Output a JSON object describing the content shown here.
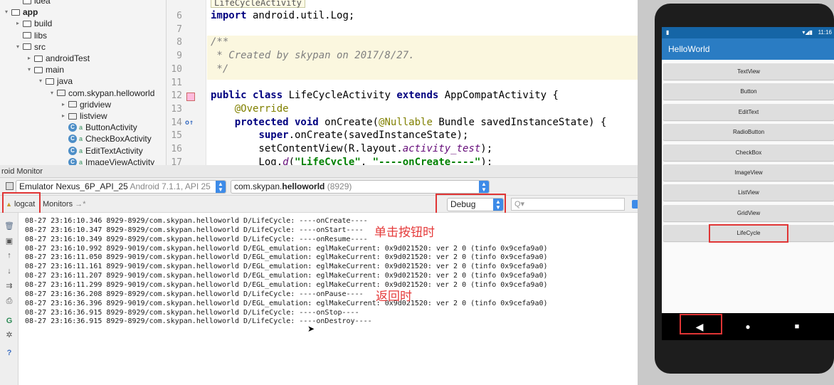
{
  "project_tree": [
    {
      "label": "idea",
      "indent": 1,
      "type": "folder",
      "twisty": "",
      "bold": false
    },
    {
      "label": "app",
      "indent": 0,
      "type": "folder",
      "twisty": "▾",
      "bold": true
    },
    {
      "label": "build",
      "indent": 1,
      "type": "folder",
      "twisty": "▸",
      "bold": false
    },
    {
      "label": "libs",
      "indent": 1,
      "type": "folder",
      "twisty": "",
      "bold": false
    },
    {
      "label": "src",
      "indent": 1,
      "type": "folder",
      "twisty": "▾",
      "bold": false
    },
    {
      "label": "androidTest",
      "indent": 2,
      "type": "folder",
      "twisty": "▸",
      "bold": false
    },
    {
      "label": "main",
      "indent": 2,
      "type": "folder",
      "twisty": "▾",
      "bold": false
    },
    {
      "label": "java",
      "indent": 3,
      "type": "folder",
      "twisty": "▾",
      "bold": false
    },
    {
      "label": "com.skypan.helloworld",
      "indent": 4,
      "type": "package",
      "twisty": "▾",
      "bold": false
    },
    {
      "label": "gridview",
      "indent": 5,
      "type": "package",
      "twisty": "▸",
      "bold": false
    },
    {
      "label": "listview",
      "indent": 5,
      "type": "package",
      "twisty": "▸",
      "bold": false
    },
    {
      "label": "ButtonActivity",
      "indent": 5,
      "type": "class",
      "twisty": "",
      "bold": false
    },
    {
      "label": "CheckBoxActivity",
      "indent": 5,
      "type": "class",
      "twisty": "",
      "bold": false
    },
    {
      "label": "EditTextActivity",
      "indent": 5,
      "type": "class",
      "twisty": "",
      "bold": false
    },
    {
      "label": "ImageViewActivity",
      "indent": 5,
      "type": "class",
      "twisty": "",
      "bold": false
    }
  ],
  "editor": {
    "tab_hint": "LifeCycleActivity",
    "lines": [
      {
        "n": "6",
        "html": "<span class=\"kw\">import</span> android.util.Log;"
      },
      {
        "n": "7",
        "html": ""
      },
      {
        "n": "8",
        "html": "<span class=\"cm\">/**</span>"
      },
      {
        "n": "9",
        "html": "<span class=\"cm\"> * Created by skypan on 2017/8/27.</span>"
      },
      {
        "n": "10",
        "html": "<span class=\"cm\"> */</span>"
      },
      {
        "n": "11",
        "html": ""
      },
      {
        "n": "12",
        "html": "<span class=\"kw\">public class</span> LifeCycleActivity <span class=\"kw\">extends</span> AppCompatActivity {"
      },
      {
        "n": "13",
        "html": "    <span class=\"an\">@Override</span>"
      },
      {
        "n": "14",
        "html": "    <span class=\"kw\">protected void</span> onCreate(<span class=\"an\">@Nullable</span> Bundle savedInstanceState) {"
      },
      {
        "n": "15",
        "html": "        <span class=\"kw\">super</span>.onCreate(savedInstanceState);"
      },
      {
        "n": "16",
        "html": "        setContentView(R.layout.<span class=\"it\">activity_test</span>);"
      },
      {
        "n": "17",
        "html": "        Log.<span class=\"it\">d</span>(<span class=\"st\">\"LifeCycle\"</span>, <span class=\"st\">\"----onCreate----\"</span>);"
      }
    ]
  },
  "monitor": {
    "title": "roid Monitor",
    "device": "Emulator Nexus_6P_API_25",
    "device_detail": "Android 7.1.1, API 25",
    "process": "com.skypan.",
    "process_bold": "helloworld",
    "process_pid": "(8929)",
    "tab_logcat": "logcat",
    "tab_monitors": "Monitors",
    "tab_monitors_suffix": "→*",
    "log_level": "Debug",
    "search_placeholder": "Q▾"
  },
  "log_lines": [
    "08-27 23:16:10.346 8929-8929/com.skypan.helloworld D/LifeCycle: ----onCreate----",
    "08-27 23:16:10.347 8929-8929/com.skypan.helloworld D/LifeCycle: ----onStart----",
    "08-27 23:16:10.349 8929-8929/com.skypan.helloworld D/LifeCycle: ----onResume----",
    "08-27 23:16:10.992 8929-9019/com.skypan.helloworld D/EGL_emulation: eglMakeCurrent: 0x9d021520: ver 2 0 (tinfo 0x9cefa9a0)",
    "08-27 23:16:11.050 8929-9019/com.skypan.helloworld D/EGL_emulation: eglMakeCurrent: 0x9d021520: ver 2 0 (tinfo 0x9cefa9a0)",
    "08-27 23:16:11.161 8929-9019/com.skypan.helloworld D/EGL_emulation: eglMakeCurrent: 0x9d021520: ver 2 0 (tinfo 0x9cefa9a0)",
    "08-27 23:16:11.207 8929-9019/com.skypan.helloworld D/EGL_emulation: eglMakeCurrent: 0x9d021520: ver 2 0 (tinfo 0x9cefa9a0)",
    "08-27 23:16:11.299 8929-9019/com.skypan.helloworld D/EGL_emulation: eglMakeCurrent: 0x9d021520: ver 2 0 (tinfo 0x9cefa9a0)",
    "08-27 23:16:36.208 8929-8929/com.skypan.helloworld D/LifeCycle: ----onPause----",
    "08-27 23:16:36.396 8929-9019/com.skypan.helloworld D/EGL_emulation: eglMakeCurrent: 0x9d021520: ver 2 0 (tinfo 0x9cefa9a0)",
    "08-27 23:16:36.915 8929-8929/com.skypan.helloworld D/LifeCycle: ----onStop----",
    "08-27 23:16:36.915 8929-8929/com.skypan.helloworld D/LifeCycle: ----onDestroy----"
  ],
  "annotations": {
    "click_button": "单击按钮时",
    "on_back": "返回时"
  },
  "phone": {
    "time": "11:16",
    "status_icons": "▾◢▮",
    "app_title": "HelloWorld",
    "buttons": [
      "TextView",
      "Button",
      "EditText",
      "RadioButton",
      "CheckBox",
      "ImageView",
      "ListView",
      "GridView",
      "LifeCycle"
    ],
    "nav_back": "◀",
    "nav_home": "●",
    "nav_recent": "■"
  },
  "colors": {
    "highlight_red": "#e03535",
    "app_bar": "#2a7cc3",
    "status_bar": "#1565a6",
    "combo_blue": "#3d8be8"
  }
}
